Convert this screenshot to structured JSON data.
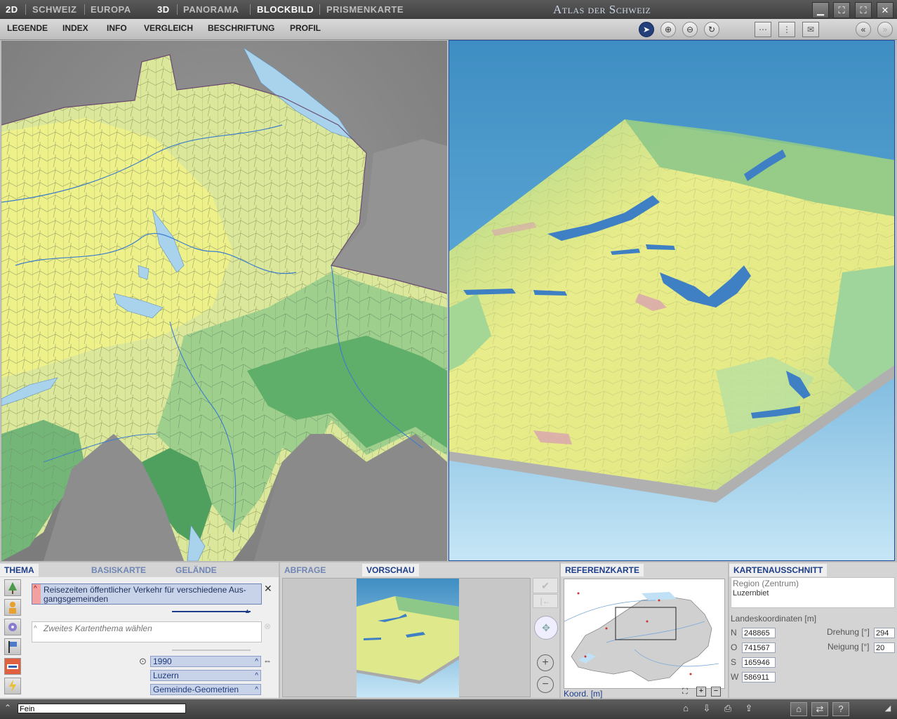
{
  "topbar": {
    "mode_2d": "2D",
    "schweiz": "SCHWEIZ",
    "europa": "EUROPA",
    "mode_3d": "3D",
    "panorama": "PANORAMA",
    "blockbild": "BLOCKBILD",
    "prismenkarte": "PRISMENKARTE",
    "app_title": "Atlas der Schweiz"
  },
  "menu": {
    "legende": "LEGENDE",
    "index": "INDEX",
    "info": "INFO",
    "vergleich": "VERGLEICH",
    "beschriftung": "BESCHRIFTUNG",
    "profil": "PROFIL"
  },
  "thema_panel": {
    "tab_thema": "THEMA",
    "tab_basiskarte": "BASISKARTE",
    "tab_gelaende": "GELÄNDE",
    "primary_theme": "Reisezeiten öffentlicher Verkehr für verschiedene Aus-gangsgemeinden",
    "secondary_placeholder": "Zweites Kartenthema wählen",
    "year": "1990",
    "region": "Luzern",
    "geometry": "Gemeinde-Geometrien"
  },
  "preview_panel": {
    "tab_abfrage": "ABFRAGE",
    "tab_vorschau": "VORSCHAU"
  },
  "reference_panel": {
    "tab": "REFERENZKARTE",
    "coord_label": "Koord. [m]"
  },
  "ausschnitt_panel": {
    "tab": "KARTENAUSSCHNITT",
    "region_label": "Region (Zentrum)",
    "region_value": "Luzernbiet",
    "coords_label": "Landeskoordinaten [m]",
    "n_label": "N",
    "n_value": "248865",
    "o_label": "O",
    "o_value": "741567",
    "s_label": "S",
    "s_value": "165946",
    "w_label": "W",
    "w_value": "586911",
    "drehung_label": "Drehung [°]",
    "drehung_value": "294",
    "neigung_label": "Neigung [°]",
    "neigung_value": "20"
  },
  "statusbar": {
    "quality_value": "Fein"
  },
  "colors": {
    "accent": "#1d3d8a",
    "water": "#a9d3ec",
    "sky": "#4a97c8"
  }
}
